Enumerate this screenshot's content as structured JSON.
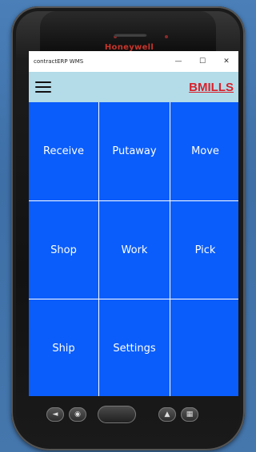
{
  "device": {
    "brand": "Honeywell"
  },
  "window": {
    "title": "contractERP WMS",
    "minimize": "—",
    "maximize": "☐",
    "close": "✕"
  },
  "appbar": {
    "menu_icon": "hamburger-menu-icon",
    "user": "BMILLS"
  },
  "tiles": [
    {
      "label": "Receive"
    },
    {
      "label": "Putaway"
    },
    {
      "label": "Move"
    },
    {
      "label": "Shop"
    },
    {
      "label": "Work"
    },
    {
      "label": "Pick"
    },
    {
      "label": "Ship"
    },
    {
      "label": "Settings"
    },
    {
      "label": ""
    }
  ],
  "hardware_keys": {
    "back": "◄",
    "home": "◉",
    "menu": "▲",
    "apps": "▦"
  },
  "colors": {
    "tile": "#0a5dfb",
    "appbar": "#b3dbe8",
    "user": "#d8202a",
    "brand": "#c6352b"
  }
}
